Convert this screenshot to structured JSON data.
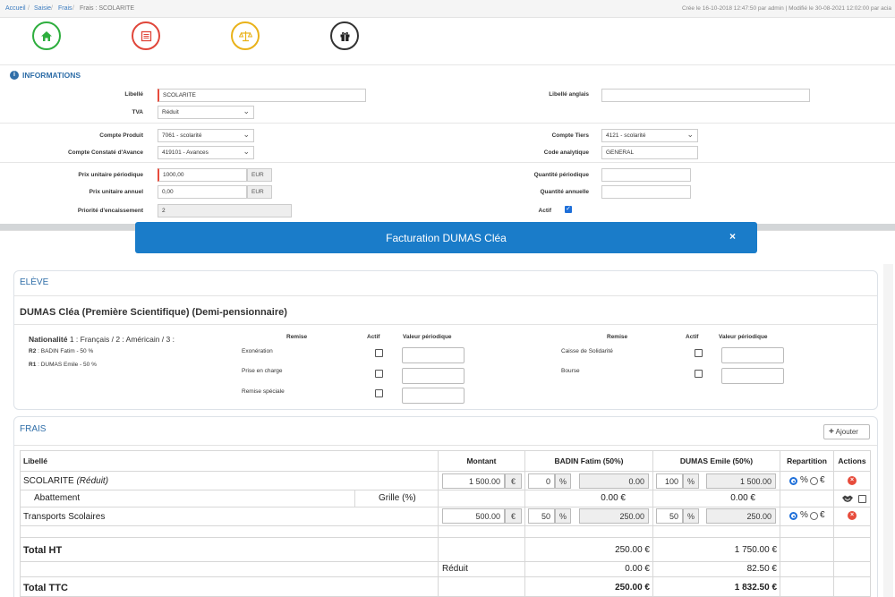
{
  "breadcrumb": {
    "home": "Accueil",
    "saisie": "Saisie",
    "frais": "Frais",
    "current": "Frais : SCOLARITE"
  },
  "meta_info": "Crée le 16-10-2018 12:47:50 par admin | Modifié le 30-08-2021 12:02:00 par acia",
  "toolbar_icons": [
    {
      "icon": "home-icon",
      "color": "#2eae3e"
    },
    {
      "icon": "list-icon",
      "color": "#e0463a"
    },
    {
      "icon": "balance-icon",
      "color": "#e9b21a"
    },
    {
      "icon": "gift-icon",
      "color": "#333333"
    }
  ],
  "informations": {
    "title": "INFORMATIONS",
    "libelle_label": "Libellé",
    "libelle_value": "SCOLARITE",
    "libelle_anglais_label": "Libellé anglais",
    "libelle_anglais_value": "",
    "tva_label": "TVA",
    "tva_value": "Réduit",
    "compte_produit_label": "Compte Produit",
    "compte_produit_value": "7061 - scolarité",
    "compte_tiers_label": "Compte Tiers",
    "compte_tiers_value": "4121 - scolarité",
    "compte_cca_label": "Compte Constaté d'Avance",
    "compte_cca_value": "419101 - Avances",
    "code_analytique_label": "Code analytique",
    "code_analytique_value": "GENERAL",
    "prix_periodique_label": "Prix unitaire périodique",
    "prix_periodique_value": "1000,00",
    "currency": "EUR",
    "quantite_periodique_label": "Quantité périodique",
    "quantite_periodique_value": "",
    "prix_annuel_label": "Prix unitaire annuel",
    "prix_annuel_value": "0,00",
    "quantite_annuelle_label": "Quantité annuelle",
    "quantite_annuelle_value": "",
    "priorite_label": "Priorité d'encaissement",
    "priorite_value": "2",
    "actif_label": "Actif"
  },
  "modal": {
    "title": "Facturation DUMAS Cléa",
    "close": "×",
    "eleve": {
      "title": "ELÈVE",
      "name": "DUMAS Cléa (Première Scientifique) (Demi-pensionnaire)",
      "nationalite_label": "Nationalité",
      "nationalite_value": "1 : Français / 2 : Américain / 3 :",
      "r2_label": "R2",
      "r2_value": ": BADIN Fatim - 50 %",
      "r1_label": "R1",
      "r1_value": ": DUMAS Emile - 50 %",
      "col_remise": "Remise",
      "col_actif": "Actif",
      "col_valeur": "Valeur périodique",
      "remises_left": [
        "Exonération",
        "Prise en charge",
        "Remise spéciale"
      ],
      "remises_right": [
        "Caisse de Solidarité",
        "Bourse"
      ]
    },
    "frais": {
      "title": "FRAIS",
      "add_label": "Ajouter",
      "headers": {
        "libelle": "Libellé",
        "montant": "Montant",
        "badin": "BADIN Fatim (50%)",
        "dumas": "DUMAS Emile (50%)",
        "repartition": "Repartition",
        "actions": "Actions"
      },
      "rows": [
        {
          "libelle": "SCOLARITE",
          "tag": "(Réduit)",
          "montant": "1 500.00",
          "cur": "€",
          "pct1": "0",
          "pct_sym": "%",
          "amt1": "0.00",
          "pct2": "100",
          "amt2": "1 500.00",
          "rep_pct": "%",
          "rep_eur": "€"
        },
        {
          "libelle": "Abattement",
          "grille": "Grille (%)",
          "amt1": "0.00 €",
          "amt2": "0.00 €"
        },
        {
          "libelle": "Transports Scolaires",
          "montant": "500.00",
          "cur": "€",
          "pct1": "50",
          "pct_sym": "%",
          "amt1": "250.00",
          "pct2": "50",
          "amt2": "250.00",
          "rep_pct": "%",
          "rep_eur": "€"
        }
      ],
      "total_ht_label": "Total HT",
      "total_ht_badin": "250.00 €",
      "total_ht_dumas": "1 750.00 €",
      "reduit_label": "Réduit",
      "reduit_badin": "0.00 €",
      "reduit_dumas": "82.50 €",
      "total_ttc_label": "Total TTC",
      "total_ttc_badin": "250.00 €",
      "total_ttc_dumas": "1 832.50 €"
    }
  }
}
